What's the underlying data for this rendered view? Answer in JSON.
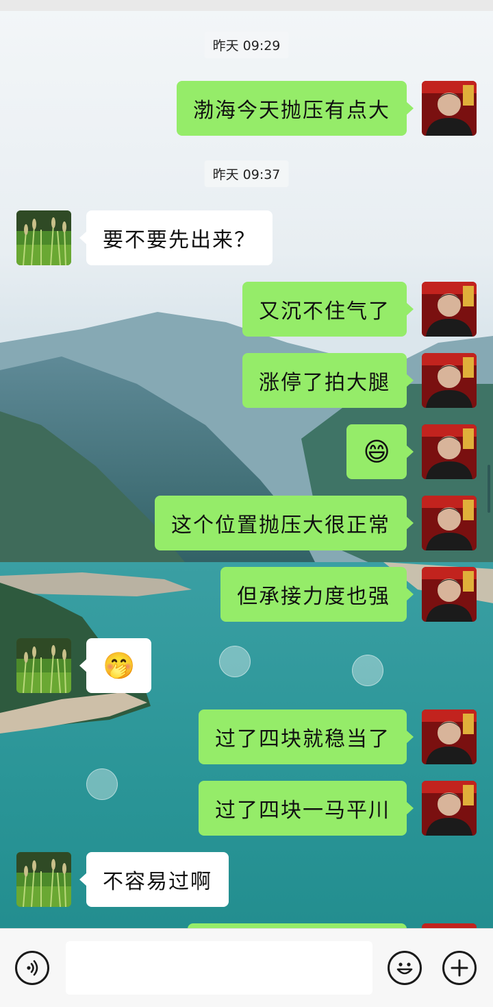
{
  "colors": {
    "sent_bubble": "#95ec69",
    "received_bubble": "#ffffff",
    "input_bar": "#f7f7f7"
  },
  "timestamps": [
    "昨天 09:29",
    "昨天 09:37"
  ],
  "messages": [
    {
      "from": "me",
      "text": "渤海今天抛压有点大"
    },
    {
      "from": "other",
      "text": "要不要先出来？"
    },
    {
      "from": "me",
      "text": "又沉不住气了"
    },
    {
      "from": "me",
      "text": "涨停了拍大腿"
    },
    {
      "from": "me",
      "text": "😄",
      "kind": "emoji"
    },
    {
      "from": "me",
      "text": "这个位置抛压大很正常"
    },
    {
      "from": "me",
      "text": "但承接力度也强"
    },
    {
      "from": "other",
      "text": "🤭",
      "kind": "emoji"
    },
    {
      "from": "me",
      "text": "过了四块就稳当了"
    },
    {
      "from": "me",
      "text": "过了四块一马平川"
    },
    {
      "from": "other",
      "text": "不容易过啊"
    }
  ],
  "avatars": {
    "me": "man-portrait-avatar",
    "other": "grass-photo-avatar"
  },
  "input_bar": {
    "voice_icon": "voice-icon",
    "text_value": "",
    "emoji_icon": "smiley-icon",
    "more_icon": "plus-icon"
  }
}
